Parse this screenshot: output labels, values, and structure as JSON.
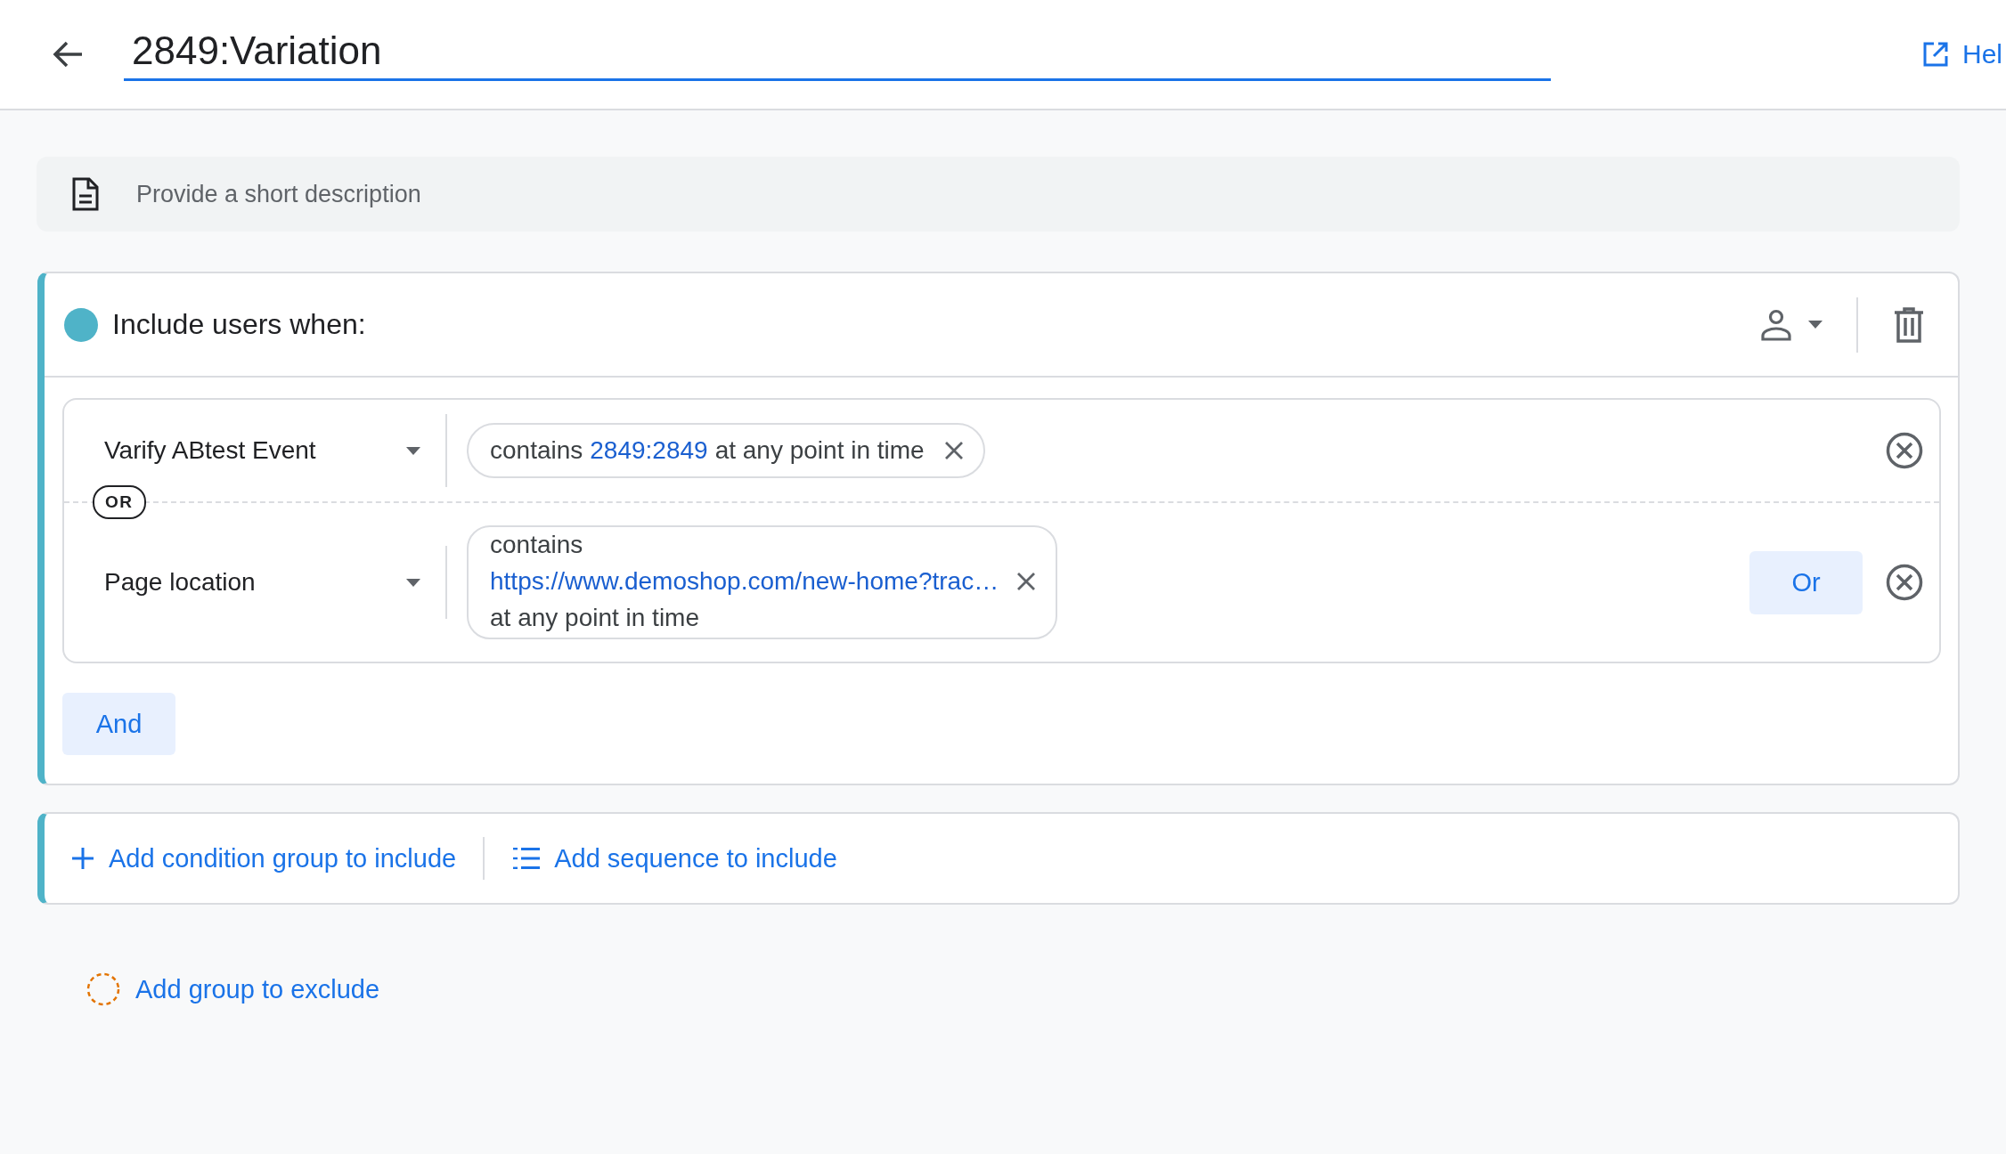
{
  "header": {
    "title_value": "2849:Variation",
    "help_link": "Hel"
  },
  "description": {
    "placeholder": "Provide a short description"
  },
  "include_group": {
    "title": "Include users when:",
    "conditions": [
      {
        "kind": "inline",
        "dimension": "Varify ABtest Event",
        "operator": "contains",
        "value": "2849:2849",
        "suffix": "at any point in time"
      },
      {
        "kind": "stacked",
        "dimension": "Page location",
        "operator": "contains",
        "value": "https://www.demoshop.com/new-home?trac…",
        "suffix": "at any point in time",
        "or_button": "Or"
      }
    ],
    "or_separator": "OR",
    "and_button": "And"
  },
  "include_actions": [
    {
      "kind": "add",
      "label": "Add condition group to include"
    },
    {
      "kind": "sequence",
      "label": "Add sequence to include"
    }
  ],
  "exclude": {
    "label": "Add group to exclude"
  }
}
